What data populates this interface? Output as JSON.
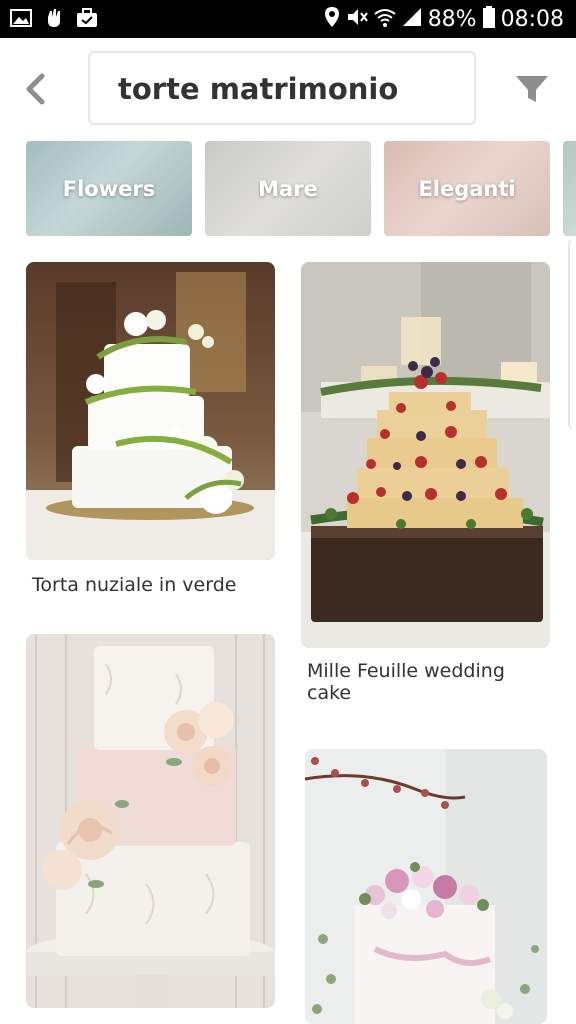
{
  "status_bar": {
    "battery": "88%",
    "time": "08:08",
    "icons_left": [
      "image-icon",
      "hand-icon",
      "briefcase-check-icon"
    ],
    "icons_right": [
      "location-icon",
      "mute-icon",
      "wifi-icon",
      "signal-icon",
      "battery-icon"
    ]
  },
  "search": {
    "query": "torte matrimonio",
    "back_icon": "chevron-left-icon",
    "filter_icon": "filter-icon"
  },
  "chips": [
    {
      "label": "Flowers"
    },
    {
      "label": "Mare"
    },
    {
      "label": "Eleganti"
    }
  ],
  "pins": [
    {
      "caption": "Torta nuziale in verde"
    },
    {
      "caption": "Mille Feuille wedding cake"
    }
  ],
  "colors": {
    "accent_gray": "#8e8e8e",
    "text": "#333333"
  }
}
